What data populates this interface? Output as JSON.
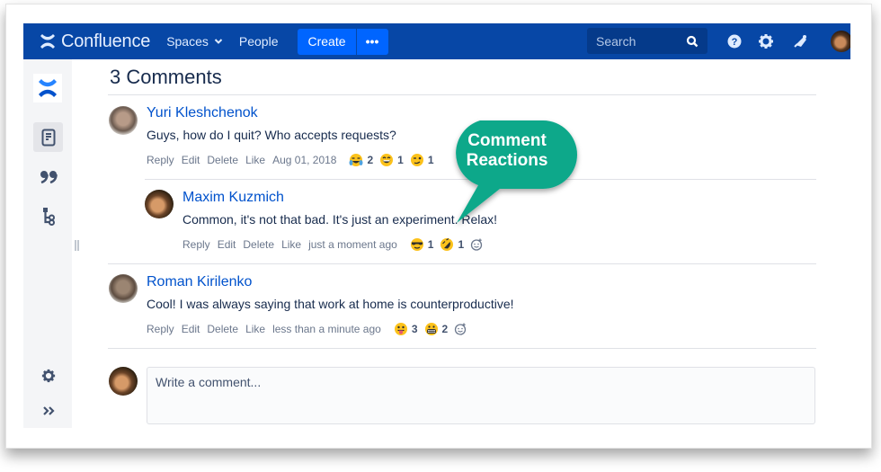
{
  "topnav": {
    "brand": "Confluence",
    "items": [
      {
        "label": "Spaces",
        "has_dropdown": true
      },
      {
        "label": "People",
        "has_dropdown": false
      }
    ],
    "create_label": "Create",
    "more_label": "•••",
    "search_placeholder": "Search",
    "icons": [
      "help-icon",
      "settings-icon",
      "notifications-icon",
      "user-avatar"
    ]
  },
  "sidebar": {
    "items": [
      "confluence-logo",
      "pages-icon",
      "blog-quote-icon",
      "page-tree-icon"
    ],
    "bottom_items": [
      "settings-icon",
      "expand-icon"
    ]
  },
  "comments_section": {
    "title": "3 Comments",
    "comments": [
      {
        "author": "Yuri Kleshchenok",
        "body": "Guys, how do I quit? Who accepts requests?",
        "actions": [
          "Reply",
          "Edit",
          "Delete",
          "Like"
        ],
        "date": "Aug 01, 2018",
        "reactions": [
          {
            "emoji": "😂",
            "name": "joy",
            "count": "2"
          },
          {
            "emoji": "😄",
            "name": "smile",
            "count": "1"
          },
          {
            "emoji": "😉",
            "name": "wink",
            "count": "1"
          }
        ],
        "nested": false
      },
      {
        "author": "Maxim Kuzmich",
        "body": "Common, it's not that bad. It's just an experiment. Relax!",
        "actions": [
          "Reply",
          "Edit",
          "Delete",
          "Like"
        ],
        "date": "just a moment ago",
        "reactions": [
          {
            "emoji": "😎",
            "name": "sunglasses",
            "count": "1"
          },
          {
            "emoji": "🤣",
            "name": "rofl",
            "count": "1"
          }
        ],
        "nested": true
      },
      {
        "author": "Roman Kirilenko",
        "body": "Cool! I was always saying that work at home is counterproductive!",
        "actions": [
          "Reply",
          "Edit",
          "Delete",
          "Like"
        ],
        "date": "less than a minute ago",
        "reactions": [
          {
            "emoji": "😛",
            "name": "tongue",
            "count": "3"
          },
          {
            "emoji": "😬",
            "name": "grimace",
            "count": "2"
          }
        ],
        "nested": false
      }
    ],
    "compose_placeholder": "Write a comment..."
  },
  "callout": {
    "text_line1": "Comment",
    "text_line2": "Reactions",
    "color": "#0aa88a"
  },
  "colors": {
    "nav_bg": "#0747a6",
    "create_btn": "#0065ff",
    "link": "#0052cc",
    "text": "#172b4d",
    "meta": "#6b778c"
  }
}
